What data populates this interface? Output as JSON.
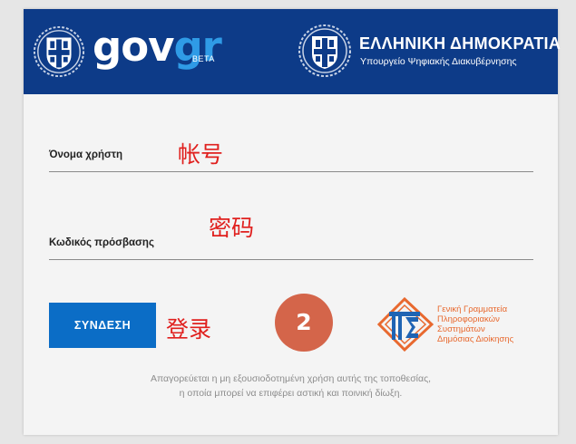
{
  "header": {
    "logo_gov": "gov",
    "logo_gr": "gr",
    "beta": "BETA",
    "republic_title": "ΕΛΛΗΝΙΚΗ ΔΗΜΟΚΡΑΤΙΑ",
    "ministry": "Υπουργείο Ψηφιακής Διακυβέρνησης",
    "background_color": "#0d3b88"
  },
  "form": {
    "username_label": "Όνομα χρήστη",
    "username_value": "",
    "password_label": "Κωδικός πρόσβασης",
    "password_value": "",
    "login_button": "ΣΥΝΔΕΣΗ",
    "button_color": "#0b6dc6"
  },
  "annotations": {
    "username": "帐号",
    "password": "密码",
    "login": "登录",
    "step_badge": "2",
    "annotation_color": "#e0201e",
    "badge_color": "#d4654a"
  },
  "gsis": {
    "lines": [
      "Γενική Γραμματεία",
      "Πληροφοριακών",
      "Συστημάτων",
      "Δημόσιας Διοίκησης"
    ],
    "color": "#e8692f",
    "icon": "gsis-logo-icon"
  },
  "disclaimer": {
    "line1": "Απαγορεύεται η μη εξουσιοδοτημένη χρήση αυτής της τοποθεσίας,",
    "line2": "η οποία μπορεί να επιφέρει αστική και ποινική δίωξη."
  },
  "icons": {
    "emblem": "greek-coat-of-arms-icon"
  }
}
